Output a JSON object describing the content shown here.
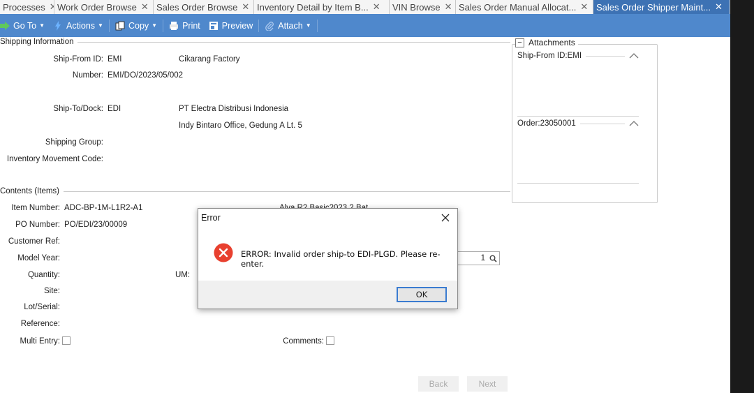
{
  "tabs": [
    {
      "label": "Processes",
      "active": false
    },
    {
      "label": "Work Order Browse",
      "active": false
    },
    {
      "label": "Sales Order Browse",
      "active": false
    },
    {
      "label": "Inventory Detail by Item B...",
      "active": false
    },
    {
      "label": "VIN Browse",
      "active": false
    },
    {
      "label": "Sales Order Manual Allocat...",
      "active": false
    },
    {
      "label": "Sales Order Shipper Maint...",
      "active": true
    }
  ],
  "toolbar": {
    "goto": "Go To",
    "actions": "Actions",
    "copy": "Copy",
    "print": "Print",
    "preview": "Preview",
    "attach": "Attach"
  },
  "shipping": {
    "section_title": "Shipping Information",
    "ship_from_label": "Ship-From ID:",
    "ship_from_id": "EMI",
    "ship_from_name": "Cikarang Factory",
    "number_label": "Number:",
    "number": "EMI/DO/2023/05/002",
    "ship_to_label": "Ship-To/Dock:",
    "ship_to_id": "EDI",
    "ship_to_name": "PT Electra Distribusi Indonesia",
    "ship_to_address": "Indy Bintaro Office, Gedung A Lt. 5",
    "shipping_group_label": "Shipping Group:",
    "inv_move_label": "Inventory Movement Code:"
  },
  "contents": {
    "section_title": "Contents (Items)",
    "item_number_label": "Item Number:",
    "item_number": "ADC-BP-1M-L1R2-A1",
    "item_desc_partial": "Alva R2 Basic2023 2 Bat",
    "po_number_label": "PO Number:",
    "po_number": "PO/EDI/23/00009",
    "customer_ref_label": "Customer Ref:",
    "model_year_label": "Model Year:",
    "quantity_label": "Quantity:",
    "um_label": "UM:",
    "site_label": "Site:",
    "lot_serial_label": "Lot/Serial:",
    "reference_label": "Reference:",
    "multi_entry_label": "Multi Entry:",
    "comments_label": "Comments:",
    "qty_field_value": "1"
  },
  "attachments": {
    "title": "Attachments",
    "groups": [
      {
        "label": "Ship-From ID:EMI"
      },
      {
        "label": "Order:23050001"
      }
    ]
  },
  "buttons": {
    "back": "Back",
    "next": "Next"
  },
  "dialog": {
    "title": "Error",
    "message": "ERROR: Invalid order ship-to EDI-PLGD.  Please re-enter.",
    "ok": "OK"
  },
  "colors": {
    "toolbar": "#4f88cc",
    "active_tab": "#3d72b4",
    "error_icon": "#e8402f"
  }
}
